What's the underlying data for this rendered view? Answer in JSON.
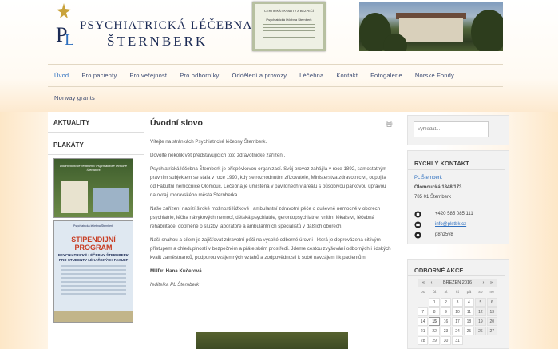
{
  "header": {
    "title": "PSYCHIATRICKÁ LÉČEBNA",
    "subtitle": "ŠTERNBERK",
    "certificate_label": "CERTIFIKÁT KVALITY A BEZPEČÍ",
    "certificate_sub": "Psychiatrická léčebna Šternberk"
  },
  "nav": {
    "row1": [
      "Úvod",
      "Pro pacienty",
      "Pro veřejnost",
      "Pro odborníky",
      "Oddělení a provozy",
      "Léčebna",
      "Kontakt",
      "Fotogalerie",
      "Norské Fondy"
    ],
    "row2": [
      "Norway grants"
    ],
    "active": "Úvod"
  },
  "left": {
    "news_title": "AKTUALITY",
    "posters_title": "PLAKÁTY",
    "poster1_text": "Dobrovolnické centrum v Psychiatrické léčebně Šternberk",
    "poster2_head": "Psychiatrická léčebna Šternberk",
    "poster2_title": "STIPENDIJNÍ PROGRAM",
    "poster2_sub": "PSYCHIATRICKÉ LÉČEBNY ŠTERNBERK PRO STUDENTY LÉKAŘSKÝCH FAKULT"
  },
  "main": {
    "title": "Úvodní slovo",
    "paragraphs": [
      "Vítejte na stránkách Psychiatrické léčebny Šternberk.",
      "Dovolte několik vět představujících toto zdravotnické zařízení.",
      "Psychiatrická léčebna Šternberk je příspěvkovou organizací. Svůj provoz zahájila v roce 1892, samostatným právním subjektem se stala v roce 1990, kdy se rozhodnutím zřizovatele, Ministerstva zdravotnictví, odpojila od Fakultní nemocnice Olomouc. Léčebna je umístěna v pavilonech v areálu s působivou parkovou úpravou na okraji moravského města Šternberka.",
      "Naše zařízení nabízí široké možnosti lůžkové i ambulantní zdravotní péče o duševně nemocné v oborech psychiatrie, léčba návykových nemocí, dětská psychiatrie, gerontopsychiatrie, vnitřní lékařství, léčebná rehabilitace, doplněné o služby laboratoře a ambulantních specialistů v dalších oborech.",
      "Naší snahou a cílem je zajišťovat zdravotní péči na vysoké odborné úrovni , která je doprovázena citlivým přístupem a ohleduplností v  bezpečném a přátelském prostředí. Jdeme cestou zvyšování odborných i lidských kvalit zaměstnanců, podporou vzájemných vztahů a zodpovědnosti k sobě navzájem i k pacientům."
    ],
    "author": "MUDr. Hana Kučerová",
    "role": "ředitelka PL Šternberk"
  },
  "right": {
    "search_placeholder": "Vyhledat...",
    "contact_title": "RYCHLÝ KONTAKT",
    "contact_name": "PL Šternberk",
    "contact_street": "Olomoucká 1848/173",
    "contact_city": "785 01 Šternberk",
    "phone": "+420 585 085 111",
    "email": "info@plstbk.cz",
    "skype": "p8hz5v8",
    "events_title": "ODBORNÉ AKCE",
    "calendar": {
      "month": "BŘEZEN 2016",
      "prev_year": "«",
      "prev_month": "‹",
      "next_month": "›",
      "next_year": "»",
      "day_names": [
        "po",
        "út",
        "st",
        "čt",
        "pá",
        "so",
        "ne"
      ],
      "weeks": [
        [
          "",
          "1",
          "2",
          "3",
          "4",
          "5",
          "6"
        ],
        [
          "7",
          "8",
          "9",
          "10",
          "11",
          "12",
          "13"
        ],
        [
          "14",
          "15",
          "16",
          "17",
          "18",
          "19",
          "20"
        ],
        [
          "21",
          "22",
          "23",
          "24",
          "25",
          "26",
          "27"
        ],
        [
          "28",
          "29",
          "30",
          "31",
          "",
          "",
          ""
        ]
      ],
      "today": "15"
    }
  },
  "colors": {
    "accent": "#2d6fbf",
    "brand": "#1c2b55",
    "poster_red": "#c83c22"
  }
}
